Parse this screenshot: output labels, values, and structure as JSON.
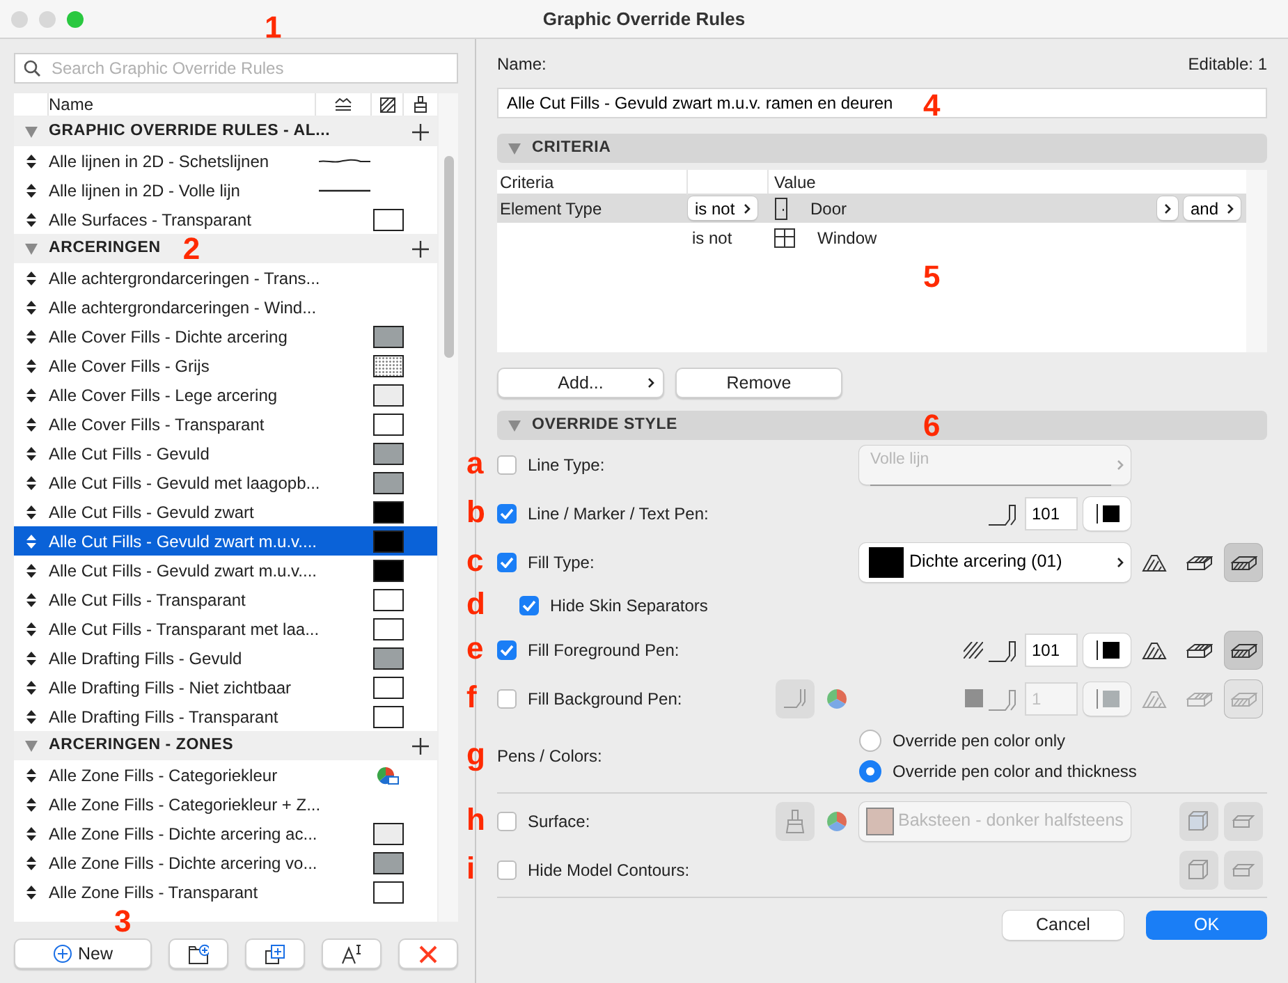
{
  "window": {
    "title": "Graphic Override Rules",
    "callout": "1"
  },
  "rules_panel": {
    "search": {
      "placeholder": "Search Graphic Override Rules"
    },
    "name_column": "Name",
    "sections": [
      {
        "title": "GRAPHIC OVERRIDE RULES - AL...",
        "expanded": true,
        "items": [
          {
            "label": "Alle lijnen in 2D - Schetslijnen",
            "kind": "sketch-line",
            "selected": false
          },
          {
            "label": "Alle lijnen in 2D - Volle lijn",
            "kind": "solid-line",
            "selected": false
          },
          {
            "label": "Alle Surfaces - Transparant",
            "kind": "white",
            "selected": false
          }
        ]
      },
      {
        "title": "ARCERINGEN",
        "expanded": true,
        "callout": "2",
        "items": [
          {
            "label": "Alle achtergrondarceringen - Trans...",
            "kind": "plain",
            "selected": false
          },
          {
            "label": "Alle achtergrondarceringen - Wind...",
            "kind": "plain",
            "selected": false
          },
          {
            "label": "Alle Cover Fills - Dichte arcering",
            "kind": "gray",
            "selected": false
          },
          {
            "label": "Alle Cover Fills - Grijs",
            "kind": "dotted",
            "selected": false
          },
          {
            "label": "Alle Cover Fills - Lege arcering",
            "kind": "light",
            "selected": false
          },
          {
            "label": "Alle Cover Fills - Transparant",
            "kind": "white",
            "selected": false
          },
          {
            "label": "Alle Cut Fills - Gevuld",
            "kind": "gray",
            "selected": false
          },
          {
            "label": "Alle Cut Fills - Gevuld met laagopb...",
            "kind": "gray",
            "selected": false
          },
          {
            "label": "Alle Cut Fills - Gevuld zwart",
            "kind": "black",
            "selected": false
          },
          {
            "label": "Alle Cut Fills - Gevuld zwart m.u.v....",
            "kind": "black",
            "selected": true
          },
          {
            "label": "Alle Cut Fills - Gevuld zwart m.u.v....",
            "kind": "black",
            "selected": false
          },
          {
            "label": "Alle Cut Fills - Transparant",
            "kind": "white",
            "selected": false
          },
          {
            "label": "Alle Cut Fills - Transparant met laa...",
            "kind": "white",
            "selected": false
          },
          {
            "label": "Alle Drafting Fills - Gevuld",
            "kind": "gray",
            "selected": false
          },
          {
            "label": "Alle Drafting Fills - Niet zichtbaar",
            "kind": "white",
            "selected": false
          },
          {
            "label": "Alle Drafting Fills - Transparant",
            "kind": "white",
            "selected": false
          }
        ]
      },
      {
        "title": "ARCERINGEN - ZONES",
        "expanded": true,
        "items": [
          {
            "label": "Alle Zone Fills - Categoriekleur",
            "kind": "category-color",
            "selected": false
          },
          {
            "label": "Alle Zone Fills - Categoriekleur + Z...",
            "kind": "plain",
            "selected": false
          },
          {
            "label": "Alle Zone Fills - Dichte arcering ac...",
            "kind": "light",
            "selected": false
          },
          {
            "label": "Alle Zone Fills - Dichte arcering vo...",
            "kind": "gray",
            "selected": false
          },
          {
            "label": "Alle Zone Fills - Transparant",
            "kind": "white",
            "selected": false
          }
        ]
      }
    ],
    "new_button": "New",
    "callout": "3"
  },
  "detail": {
    "name_label": "Name:",
    "editable": "Editable: 1",
    "name_value": "Alle Cut Fills - Gevuld zwart m.u.v. ramen en deuren",
    "name_callout": "4",
    "criteria": {
      "title": "CRITERIA",
      "expanded": true,
      "callout": "5",
      "columns": [
        "Criteria",
        "Value"
      ],
      "rows": [
        {
          "criteria": "Element Type",
          "operator": "is not",
          "kind": "door",
          "value": "Door",
          "conjunction": "and",
          "selected": true
        },
        {
          "operator": "is not",
          "kind": "window",
          "value": "Window",
          "selected": false
        }
      ],
      "add_button": "Add...",
      "remove_button": "Remove"
    },
    "override_style": {
      "title": "OVERRIDE STYLE",
      "expanded": true,
      "callout": "6",
      "rows": [
        {
          "kind": "line-type",
          "callout": "a",
          "label": "Line Type:",
          "checked": false,
          "value": "Volle lijn"
        },
        {
          "kind": "pen",
          "callout": "b",
          "label": "Line / Marker / Text Pen:",
          "checked": true,
          "pen": "101"
        },
        {
          "kind": "fill-type",
          "callout": "c",
          "label": "Fill Type:",
          "checked": true,
          "value": "Dichte arcering (01)",
          "views": [
            {
              "selected": false
            },
            {
              "selected": false
            },
            {
              "selected": true
            }
          ]
        },
        {
          "kind": "sub-check",
          "callout": "d",
          "label": "Hide Skin Separators",
          "checked": true
        },
        {
          "kind": "fill-pen",
          "callout": "e",
          "label": "Fill Foreground Pen:",
          "checked": true,
          "pen": "101",
          "views": [
            {
              "selected": false
            },
            {
              "selected": false
            },
            {
              "selected": true
            }
          ]
        },
        {
          "kind": "bg-pen",
          "callout": "f",
          "label": "Fill Background Pen:",
          "checked": false,
          "pen": "1",
          "views": [
            {
              "selected": false
            },
            {
              "selected": false
            },
            {
              "selected": true
            }
          ]
        },
        {
          "kind": "radio-group",
          "callout": "g",
          "label": "Pens / Colors:",
          "options": [
            {
              "label": "Override pen color only",
              "selected": false
            },
            {
              "label": "Override pen color and thickness",
              "selected": true
            }
          ]
        },
        {
          "kind": "surface",
          "callout": "h",
          "label": "Surface:",
          "checked": false,
          "value": "Baksteen - donker halfsteens"
        },
        {
          "kind": "check-only",
          "callout": "i",
          "label": "Hide Model Contours:",
          "checked": false
        }
      ]
    },
    "buttons": [
      {
        "label": "Cancel",
        "primary": false
      },
      {
        "label": "OK",
        "primary": true
      }
    ]
  }
}
